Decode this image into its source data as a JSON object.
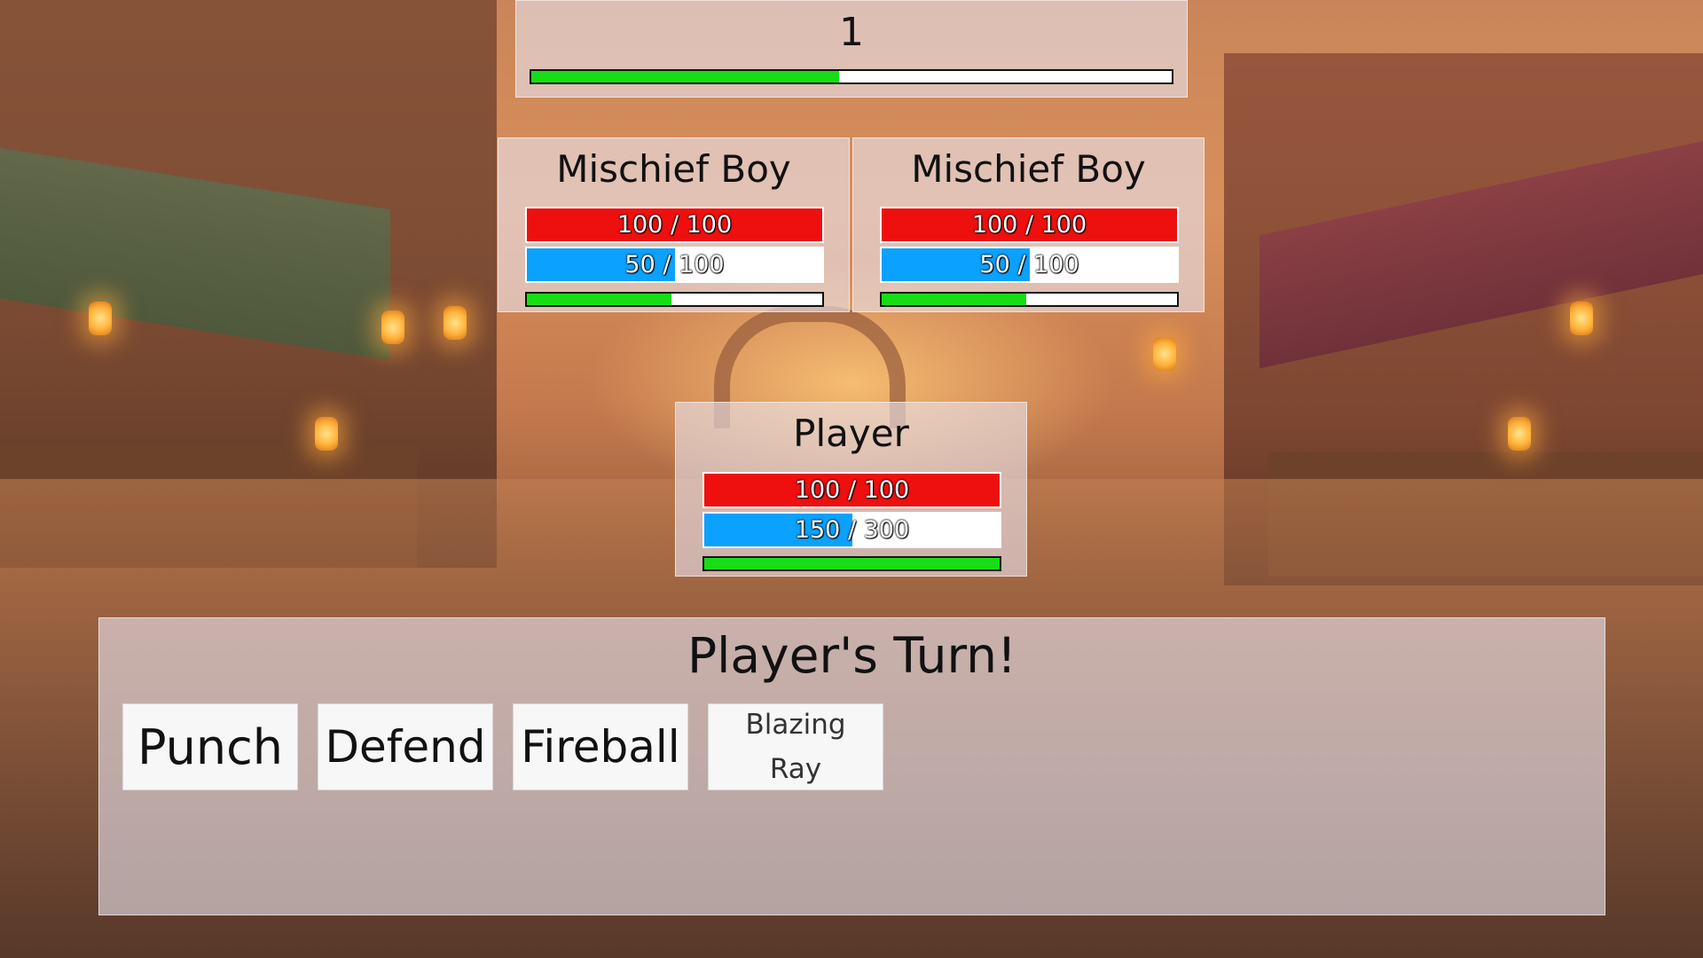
{
  "turn_counter": {
    "value": "1",
    "progress": 0.48
  },
  "enemies": [
    {
      "name": "Mischief Boy",
      "hp_text": "100 / 100",
      "hp_fraction": 1.0,
      "mp_text": "50 / 100",
      "mp_fraction": 0.5,
      "atb_fraction": 0.49
    },
    {
      "name": "Mischief Boy",
      "hp_text": "100 / 100",
      "hp_fraction": 1.0,
      "mp_text": "50 / 100",
      "mp_fraction": 0.5,
      "atb_fraction": 0.49
    }
  ],
  "player": {
    "name": "Player",
    "hp_text": "100 / 100",
    "hp_fraction": 1.0,
    "mp_text": "150 / 300",
    "mp_fraction": 0.5,
    "atb_fraction": 1.0
  },
  "action_panel": {
    "title": "Player's Turn!",
    "actions": [
      {
        "label": "Punch"
      },
      {
        "label": "Defend"
      },
      {
        "label": "Fireball"
      },
      {
        "label": "Blazing Ray"
      }
    ]
  },
  "colors": {
    "hp": "#ee0f0f",
    "mp": "#0aa1ff",
    "atb": "#17dd17",
    "panel": "#e9e2ec"
  }
}
